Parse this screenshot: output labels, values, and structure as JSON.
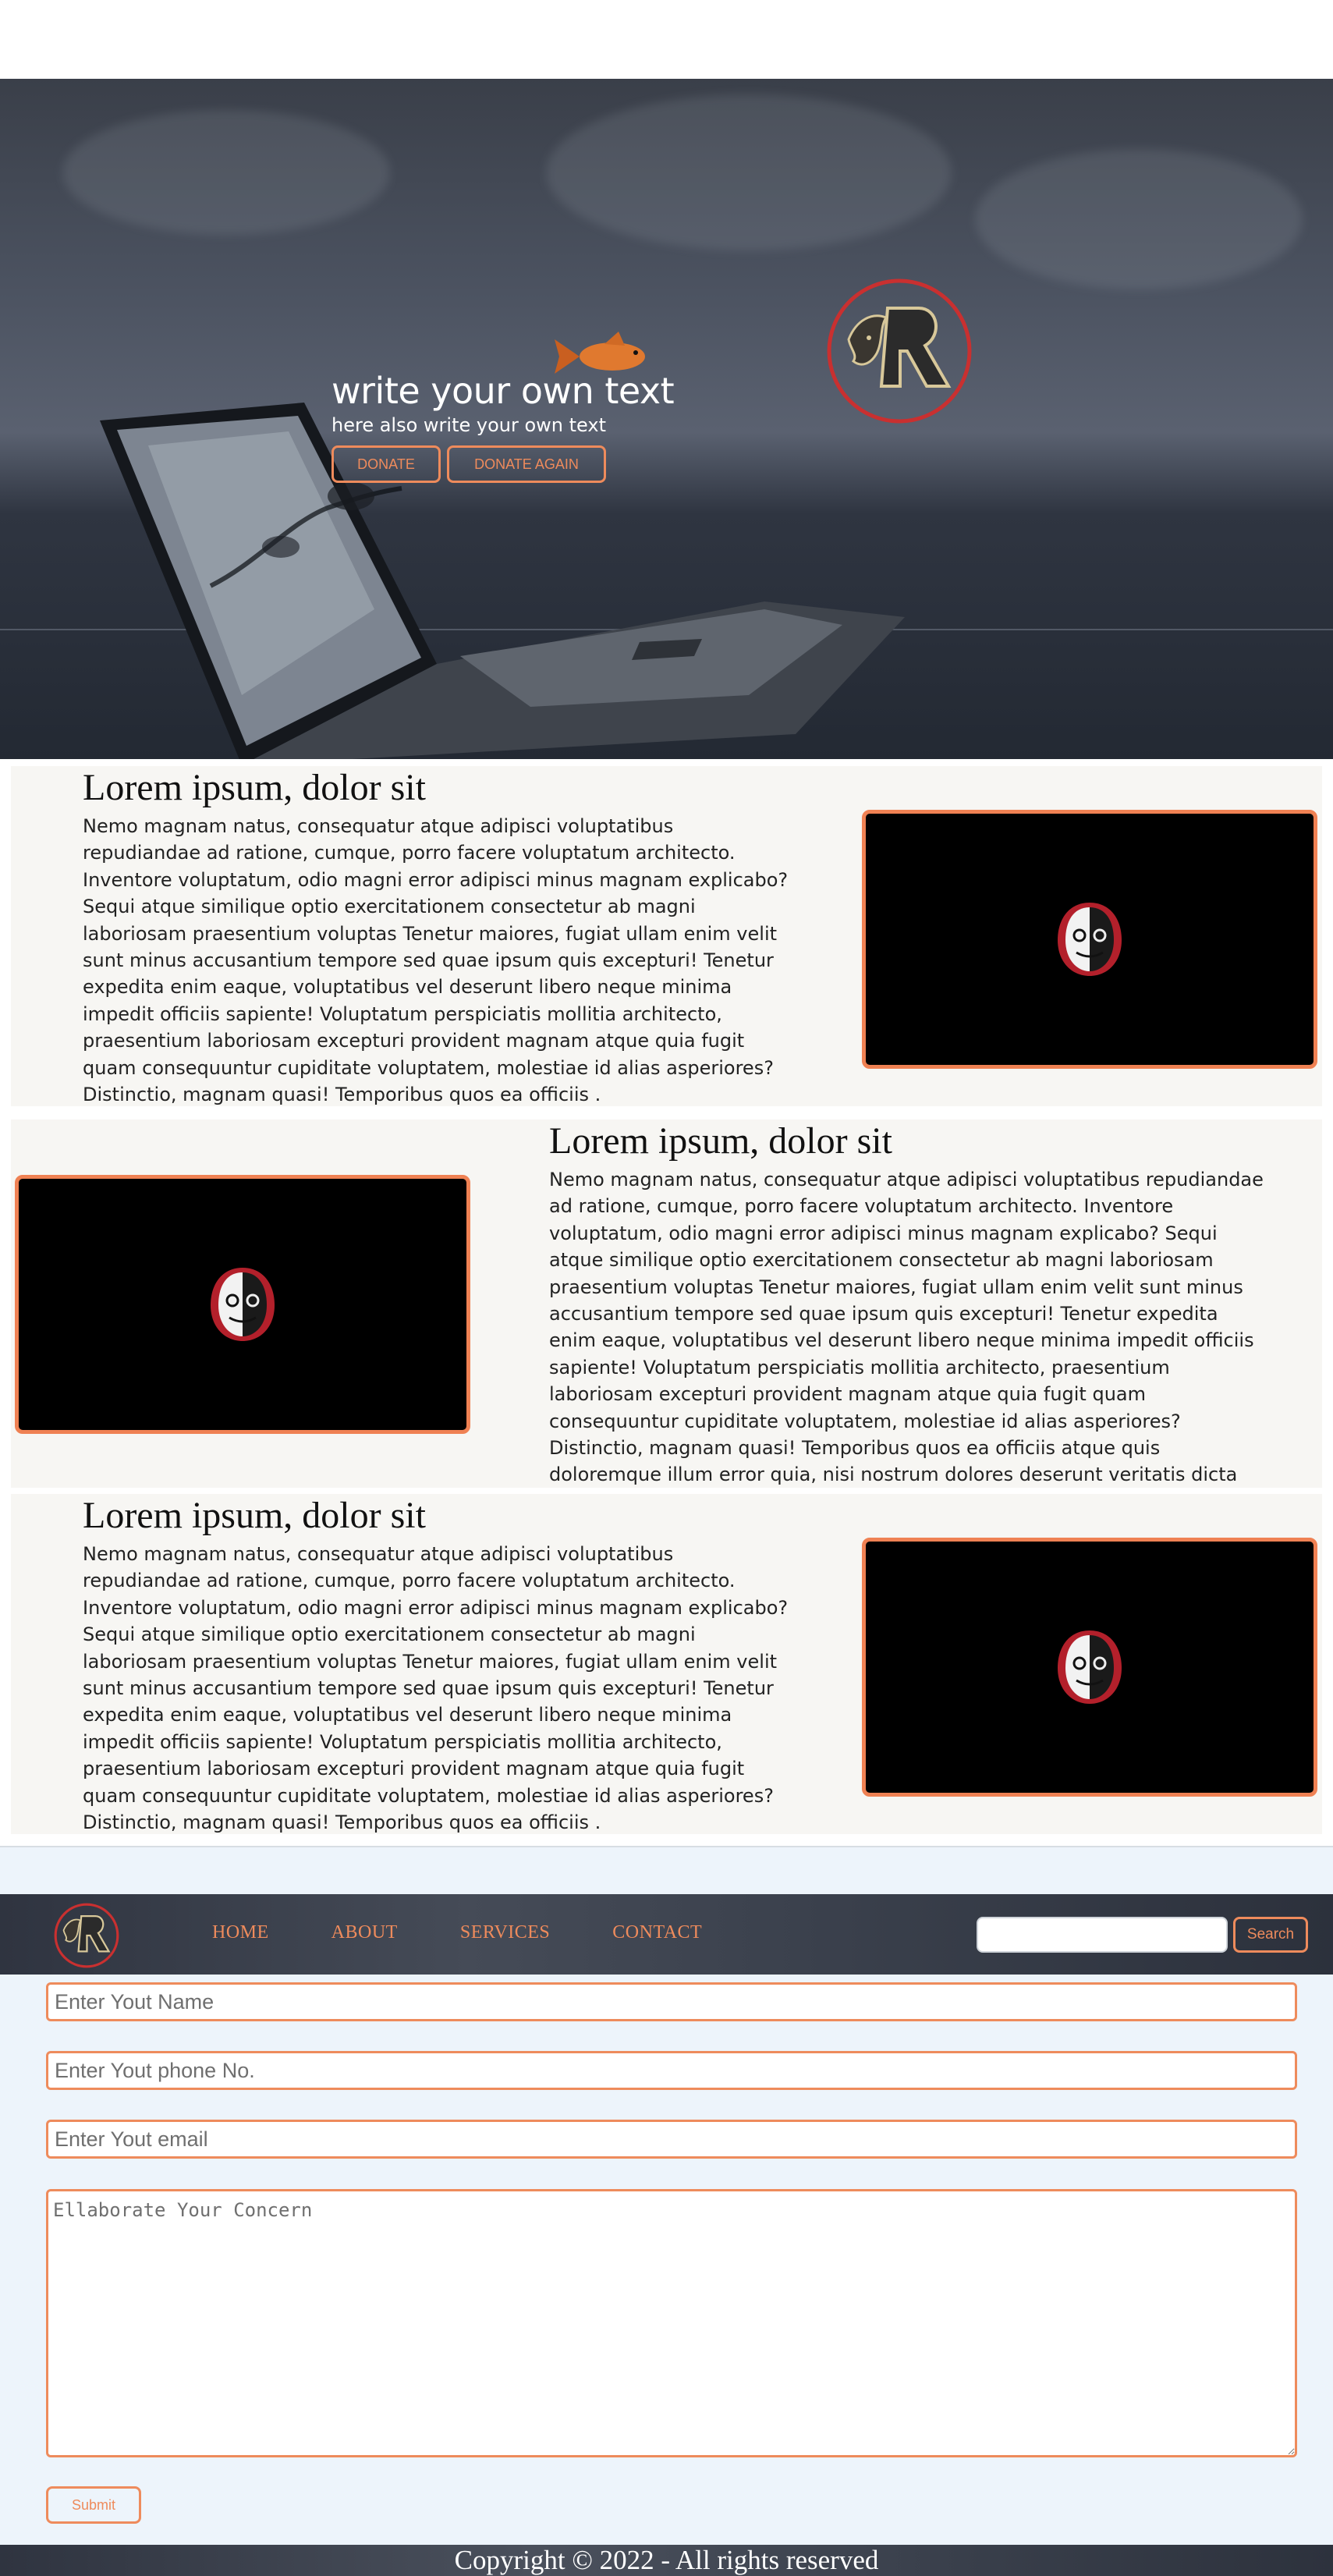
{
  "hero": {
    "title": "write your own text",
    "subtitle": "here also write your own text",
    "buttons": [
      "DONATE",
      "DONATE AGAIN"
    ]
  },
  "sections": [
    {
      "heading": "Lorem ipsum, dolor sit",
      "text": "Nemo magnam natus, consequatur atque adipisci voluptatibus repudiandae ad ratione, cumque, porro facere voluptatum architecto. Inventore voluptatum, odio magni error adipisci minus magnam explicabo? Sequi atque similique optio exercitationem consectetur ab magni laboriosam praesentium voluptas Tenetur maiores, fugiat ullam enim velit sunt minus accusantium tempore sed quae ipsum quis excepturi! Tenetur expedita enim eaque, voluptatibus vel deserunt libero neque minima impedit officiis sapiente! Voluptatum perspiciatis mollitia architecto, praesentium laboriosam excepturi provident magnam atque quia fugit quam consequuntur cupiditate voluptatem, molestiae id alias asperiores? Distinctio, magnam quasi! Temporibus quos ea officiis ."
    },
    {
      "heading": "Lorem ipsum, dolor sit",
      "text": "Nemo magnam natus, consequatur atque adipisci voluptatibus repudiandae ad ratione, cumque, porro facere voluptatum architecto. Inventore voluptatum, odio magni error adipisci minus magnam explicabo? Sequi atque similique optio exercitationem consectetur ab magni laboriosam praesentium voluptas Tenetur maiores, fugiat ullam enim velit sunt minus accusantium tempore sed quae ipsum quis excepturi! Tenetur expedita enim eaque, voluptatibus vel deserunt libero neque minima impedit officiis sapiente! Voluptatum perspiciatis mollitia architecto, praesentium laboriosam excepturi provident magnam atque quia fugit quam consequuntur cupiditate voluptatem, molestiae id alias asperiores? Distinctio, magnam quasi! Temporibus quos ea officiis atque quis doloremque illum error quia, nisi nostrum dolores deserunt veritatis dicta tenetur."
    },
    {
      "heading": "Lorem ipsum, dolor sit",
      "text": "Nemo magnam natus, consequatur atque adipisci voluptatibus repudiandae ad ratione, cumque, porro facere voluptatum architecto. Inventore voluptatum, odio magni error adipisci minus magnam explicabo? Sequi atque similique optio exercitationem consectetur ab magni laboriosam praesentium voluptas Tenetur maiores, fugiat ullam enim velit sunt minus accusantium tempore sed quae ipsum quis excepturi! Tenetur expedita enim eaque, voluptatibus vel deserunt libero neque minima impedit officiis sapiente! Voluptatum perspiciatis mollitia architecto, praesentium laboriosam excepturi provident magnam atque quia fugit quam consequuntur cupiditate voluptatem, molestiae id alias asperiores? Distinctio, magnam quasi! Temporibus quos ea officiis ."
    }
  ],
  "navbar": {
    "links": [
      "HOME",
      "ABOUT",
      "SERVICES",
      "CONTACT"
    ],
    "search_placeholder": "",
    "search_button": "Search"
  },
  "contact": {
    "name_placeholder": "Enter Yout Name",
    "phone_placeholder": "Enter Yout phone No.",
    "email_placeholder": "Enter Yout email",
    "concern_placeholder": "Ellaborate Your Concern",
    "submit_label": "Submit"
  },
  "footer": {
    "text": "Copyright © 2022 - All rights reserved"
  },
  "colors": {
    "accent": "#ee8b5c",
    "section_bg": "#f7f6f3",
    "contact_bg": "#edf4fb"
  },
  "icons": {
    "brand_logo": "lion-r-logo-icon",
    "media_thumbnail": "masked-face-icon"
  }
}
